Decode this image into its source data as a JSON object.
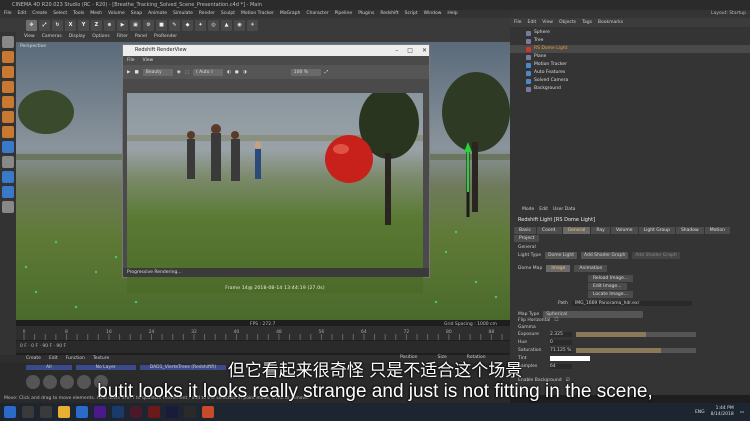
{
  "window": {
    "title": "CINEMA 4D R20.023 Studio (RC - R20) - [Breathe_Tracking_Solved_Scene_Presentation.c4d *] - Main"
  },
  "menu": [
    "File",
    "Edit",
    "Create",
    "Select",
    "Tools",
    "Mesh",
    "Volume",
    "Snap",
    "Animate",
    "Simulate",
    "Render",
    "Sculpt",
    "Motion Tracker",
    "MoGraph",
    "Character",
    "Pipeline",
    "Plugins",
    "Redshift",
    "Script",
    "Window",
    "Help"
  ],
  "toolbar": {
    "axis_x": "X",
    "axis_y": "Y",
    "axis_z": "Z"
  },
  "viewport": {
    "menu": [
      "View",
      "Cameras",
      "Display",
      "Options",
      "Filter",
      "Panel",
      "ProRender"
    ],
    "label": "Perspective",
    "fps": "FPS : 272.7",
    "grid": "Grid Spacing : 1000 cm"
  },
  "timeline": {
    "ticks": [
      "0",
      "2",
      "4",
      "6",
      "8",
      "10",
      "12",
      "14",
      "16",
      "18",
      "20",
      "22",
      "24",
      "26",
      "28",
      "30",
      "32",
      "34",
      "36",
      "38",
      "40",
      "42",
      "44",
      "46",
      "48",
      "50",
      "52",
      "54",
      "56",
      "58",
      "60",
      "62",
      "64",
      "66",
      "68",
      "70",
      "72",
      "74",
      "76",
      "78",
      "80",
      "82",
      "84",
      "86",
      "88",
      "90"
    ],
    "transport": "0 F  ·  0 F  ·  90 F  ·  90 F"
  },
  "renderview": {
    "title": "Redshift RenderView",
    "menu": [
      "File",
      "View"
    ],
    "mode": "Beauty",
    "aov": "( Auto )",
    "zoom": "100 %",
    "stamp": "Frame  14@  2018-08-14  13:44:19  (27.0s)",
    "status": "Progressive Rendering..."
  },
  "objects": {
    "menu": [
      "File",
      "Edit",
      "View",
      "Objects",
      "Tags",
      "Bookmarks"
    ],
    "layout": "Layout:  Startup",
    "items": [
      {
        "name": "Sphere",
        "color": "#7a7aa0"
      },
      {
        "name": "Tree",
        "color": "#7a7aa0"
      },
      {
        "name": "RS Dome Light",
        "color": "#c83a2a",
        "selected": true
      },
      {
        "name": "Plane",
        "color": "#7a7aa0"
      },
      {
        "name": "Motion Tracker",
        "color": "#4a8ac8"
      },
      {
        "name": "Auto Features",
        "color": "#4a8ac8"
      },
      {
        "name": "Solved Camera",
        "color": "#4a8ac8"
      },
      {
        "name": "Background",
        "color": "#7a7aa0"
      }
    ]
  },
  "attributes": {
    "menu": [
      "Mode",
      "Edit",
      "User Data"
    ],
    "title": "Redshift Light [RS Dome Light]",
    "tabs": [
      "Basic",
      "Coord.",
      "General",
      "Ray",
      "Volume",
      "Light Group",
      "Shadow",
      "Motion",
      "Project"
    ],
    "active_tab": "General",
    "section": "General",
    "light_type_label": "Light Type",
    "light_type_value": "Dome Light",
    "add_shader": "Add Shader Graph",
    "add_shader2": "Add Shader Graph",
    "dome_map": "Dome Map",
    "image_tab": "Image",
    "animation_tab": "Animation",
    "reload": "Reload Image...",
    "edit": "Edit Image...",
    "locate": "Locate Image...",
    "path_label": "Path",
    "path": "IMG_1669 Panorama_hdr.exr",
    "map_type_label": "Map Type",
    "map_type": "Spherical",
    "flip_label": "Flip Horizontal",
    "gamma_label": "Gamma",
    "exposure_label": "Exposure",
    "exposure": "2.325",
    "hue_label": "Hue",
    "hue": "0",
    "sat_label": "Saturation",
    "sat": "71.125 %",
    "tint_label": "Tint",
    "samples_label": "Samples",
    "samples": "64",
    "bg_label": "Enable Background"
  },
  "materials": {
    "menu": [
      "Create",
      "Edit",
      "Function",
      "Texture"
    ],
    "layers": [
      "All",
      "No Layer",
      "DAD1_VierteTrees (RedshiftR)"
    ],
    "coord_head": [
      "Position",
      "Size",
      "Rotation"
    ]
  },
  "status": "Move: Click and drag to move elements. Hold down SHIFT to quantize movement / add to the selection in point mode, CTRL to remove.",
  "subtitles": {
    "cn": "但它看起来很奇怪 只是不适合这个场景",
    "en": "butit looks it looks really strange and just is not fitting in the scene,"
  },
  "tray": {
    "lang": "ENG",
    "time": "1:44 PM",
    "date": "8/14/2018"
  }
}
